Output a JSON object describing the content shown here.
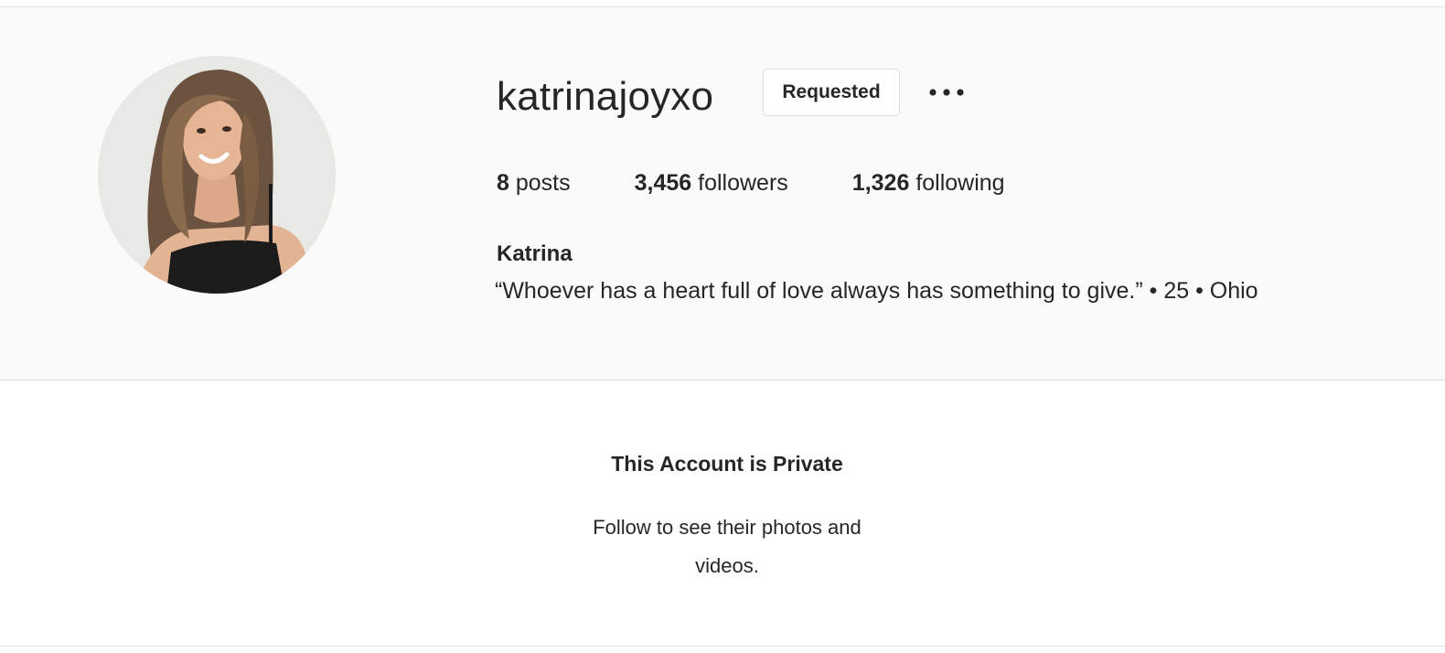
{
  "profile": {
    "username": "katrinajoyxo",
    "requested_label": "Requested",
    "more_icon": "more-horizontal-icon",
    "avatar_alt": "profile-photo",
    "stats": {
      "posts_count": "8",
      "posts_label": "posts",
      "followers_count": "3,456",
      "followers_label": "followers",
      "following_count": "1,326",
      "following_label": "following"
    },
    "full_name": "Katrina",
    "bio": "“Whoever has a heart full of love always has something to give.” • 25 • Ohio"
  },
  "private_notice": {
    "title": "This Account is Private",
    "subtitle_line1": "Follow to see their photos and",
    "subtitle_line2": "videos."
  },
  "colors": {
    "header_bg": "#fafafa",
    "text": "#262626",
    "border": "#dbdbdb"
  }
}
